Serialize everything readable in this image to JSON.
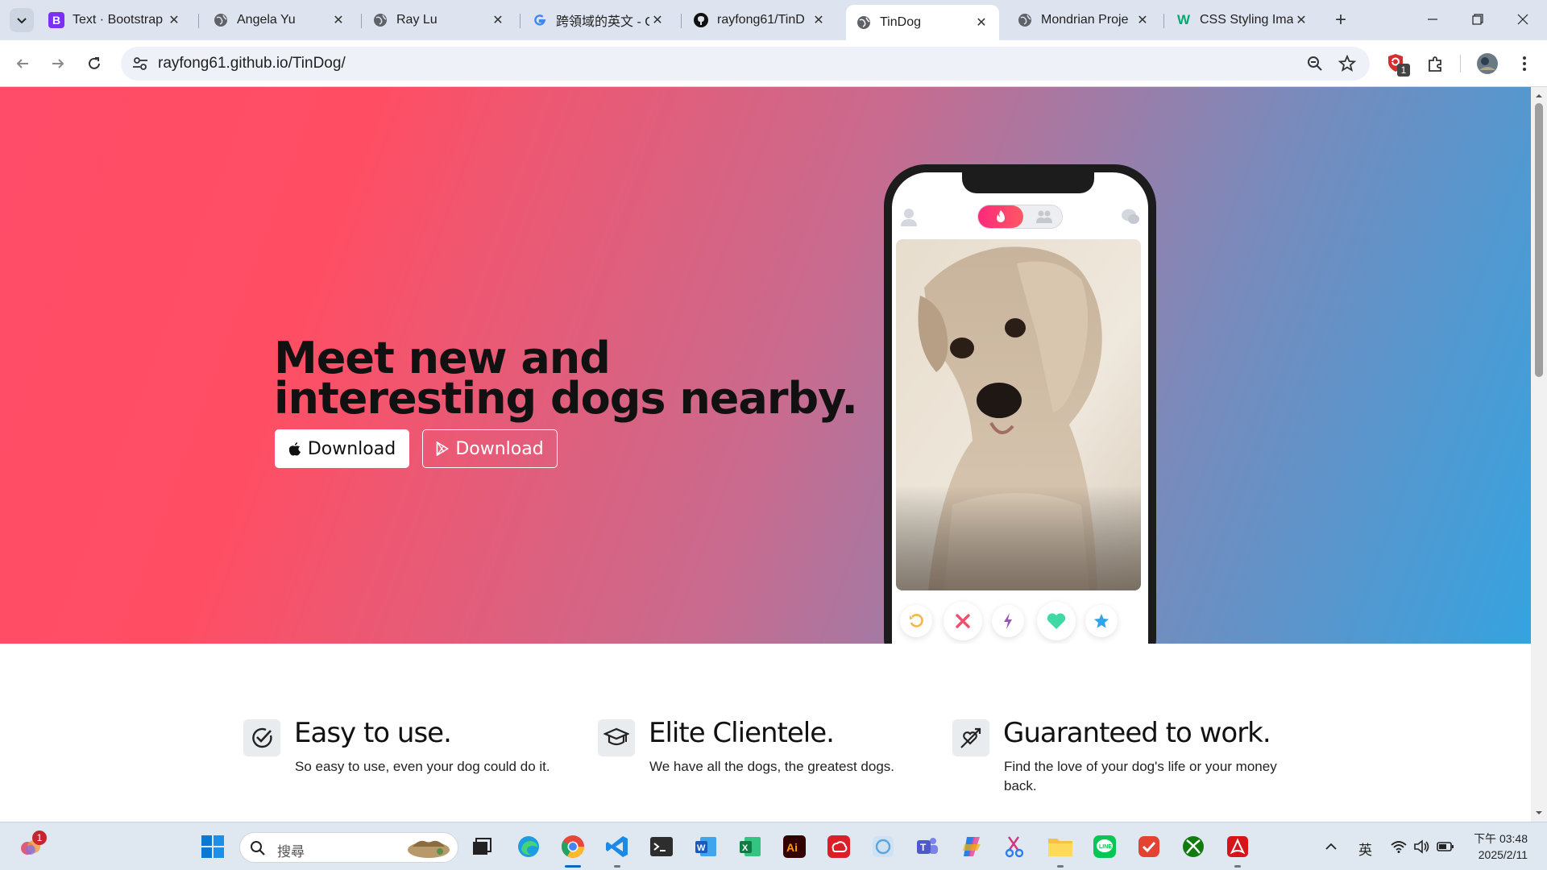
{
  "browser": {
    "tabs": [
      {
        "title": "Text · Bootstrap",
        "icon": "bootstrap-icon"
      },
      {
        "title": "Angela Yu",
        "icon": "globe-icon"
      },
      {
        "title": "Ray Lu",
        "icon": "globe-icon"
      },
      {
        "title": "跨領域的英文 - G",
        "icon": "google-icon"
      },
      {
        "title": "rayfong61/TinD",
        "icon": "github-icon"
      },
      {
        "title": "TinDog",
        "icon": "globe-icon",
        "active": true
      },
      {
        "title": "Mondrian Proje",
        "icon": "globe-icon"
      },
      {
        "title": "CSS Styling Ima",
        "icon": "w3-icon"
      }
    ],
    "url": "rayfong61.github.io/TinDog/",
    "extension_badge": "1"
  },
  "page": {
    "headline_line1": "Meet new and",
    "headline_line2": "interesting dogs nearby.",
    "download_apple": "Download",
    "download_google": "Download",
    "features": [
      {
        "title": "Easy to use.",
        "text": "So easy to use, even your dog could do it.",
        "icon": "check-circle-icon"
      },
      {
        "title": "Elite Clientele.",
        "text": "We have all the dogs, the greatest dogs.",
        "icon": "graduation-cap-icon"
      },
      {
        "title": "Guaranteed to work.",
        "text": "Find the love of your dog's life or your money back.",
        "icon": "heart-arrow-icon"
      }
    ]
  },
  "taskbar": {
    "notification_badge": "1",
    "search_placeholder": "搜尋",
    "ime_label": "英",
    "time": "下午 03:48",
    "date": "2025/2/11"
  },
  "colors": {
    "hero_start": "#ff4c68",
    "hero_end": "#35a3e0",
    "tinder_accent": "#fd297b"
  }
}
